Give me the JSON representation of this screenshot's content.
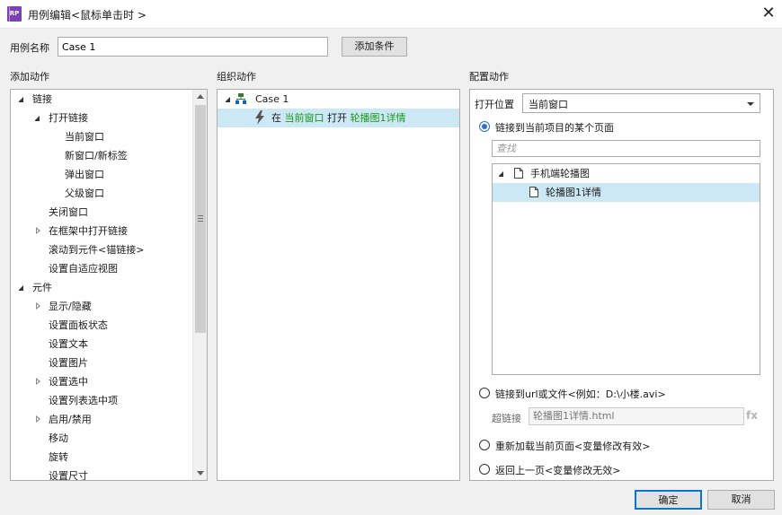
{
  "window": {
    "icon_text": "RP",
    "title": "用例编辑<鼠标单击时 >",
    "close_glyph": "✕"
  },
  "case_name": {
    "label": "用例名称",
    "value": "Case 1",
    "add_condition_label": "添加条件"
  },
  "sections": {
    "add_actions": "添加动作",
    "organize_actions": "组织动作",
    "configure_actions": "配置动作"
  },
  "actions_tree": [
    {
      "label": "链接",
      "level": 0,
      "state": "open"
    },
    {
      "label": "打开链接",
      "level": 1,
      "state": "open"
    },
    {
      "label": "当前窗口",
      "level": 2,
      "state": "leaf"
    },
    {
      "label": "新窗口/新标签",
      "level": 2,
      "state": "leaf"
    },
    {
      "label": "弹出窗口",
      "level": 2,
      "state": "leaf"
    },
    {
      "label": "父级窗口",
      "level": 2,
      "state": "leaf"
    },
    {
      "label": "关闭窗口",
      "level": 1,
      "state": "leaf"
    },
    {
      "label": "在框架中打开链接",
      "level": 1,
      "state": "closed"
    },
    {
      "label": "滚动到元件<锚链接>",
      "level": 1,
      "state": "leaf"
    },
    {
      "label": "设置自适应视图",
      "level": 1,
      "state": "leaf"
    },
    {
      "label": "元件",
      "level": 0,
      "state": "open"
    },
    {
      "label": "显示/隐藏",
      "level": 1,
      "state": "closed"
    },
    {
      "label": "设置面板状态",
      "level": 1,
      "state": "leaf"
    },
    {
      "label": "设置文本",
      "level": 1,
      "state": "leaf"
    },
    {
      "label": "设置图片",
      "level": 1,
      "state": "leaf"
    },
    {
      "label": "设置选中",
      "level": 1,
      "state": "closed"
    },
    {
      "label": "设置列表选中项",
      "level": 1,
      "state": "leaf"
    },
    {
      "label": "启用/禁用",
      "level": 1,
      "state": "closed"
    },
    {
      "label": "移动",
      "level": 1,
      "state": "leaf"
    },
    {
      "label": "旋转",
      "level": 1,
      "state": "leaf"
    },
    {
      "label": "设置尺寸",
      "level": 1,
      "state": "leaf"
    }
  ],
  "organize": {
    "case_label": "Case 1",
    "action": {
      "prefix": "在",
      "target": "当前窗口",
      "verb": "打开",
      "page": "轮播图1详情"
    }
  },
  "config": {
    "open_in_label": "打开位置",
    "open_in_value": "当前窗口",
    "radio_page": "链接到当前项目的某个页面",
    "find_placeholder": "查找",
    "page_tree": {
      "folder": "手机端轮播图",
      "page": "轮播图1详情"
    },
    "radio_url": "链接到url或文件<例如：D:\\小楼.avi>",
    "hyperlink_label": "超链接",
    "hyperlink_value": "轮播图1详情.html",
    "fx_label": "fx",
    "radio_reload": "重新加载当前页面<变量修改有效>",
    "radio_back": "返回上一页<变量修改无效>"
  },
  "footer": {
    "ok_label": "确定",
    "cancel_label": "取消"
  },
  "colors": {
    "selection": "#cce8f4",
    "accent": "#0078d7",
    "link_green": "#1a9a1a",
    "app_icon": "#7b3fb6"
  }
}
